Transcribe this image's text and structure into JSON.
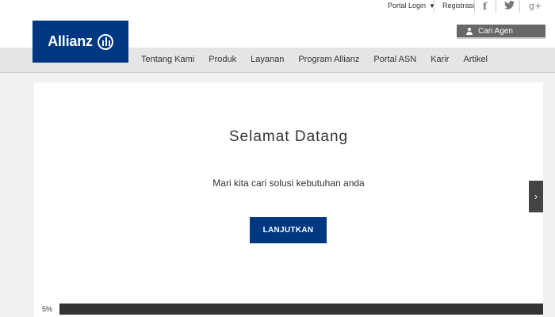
{
  "topbar": {
    "portal_login": "Portal Login",
    "registrasi": "Registrasi",
    "social": {
      "facebook": "f",
      "twitter": "🐦",
      "google_plus": "g+"
    }
  },
  "brand": {
    "name": "Allianz",
    "color": "#003781"
  },
  "header": {
    "cari_agen": "Cari Agen"
  },
  "nav": {
    "items": [
      "Tentang Kami",
      "Produk",
      "Layanan",
      "Program Allianz",
      "Portal ASN",
      "Karir",
      "Artikel"
    ]
  },
  "main": {
    "title": "Selamat Datang",
    "subtitle": "Mari kita cari solusi kebutuhan anda",
    "cta": "LANJUTKAN",
    "next_arrow": "›"
  },
  "progress": {
    "label": "5%",
    "value": 0.05
  }
}
